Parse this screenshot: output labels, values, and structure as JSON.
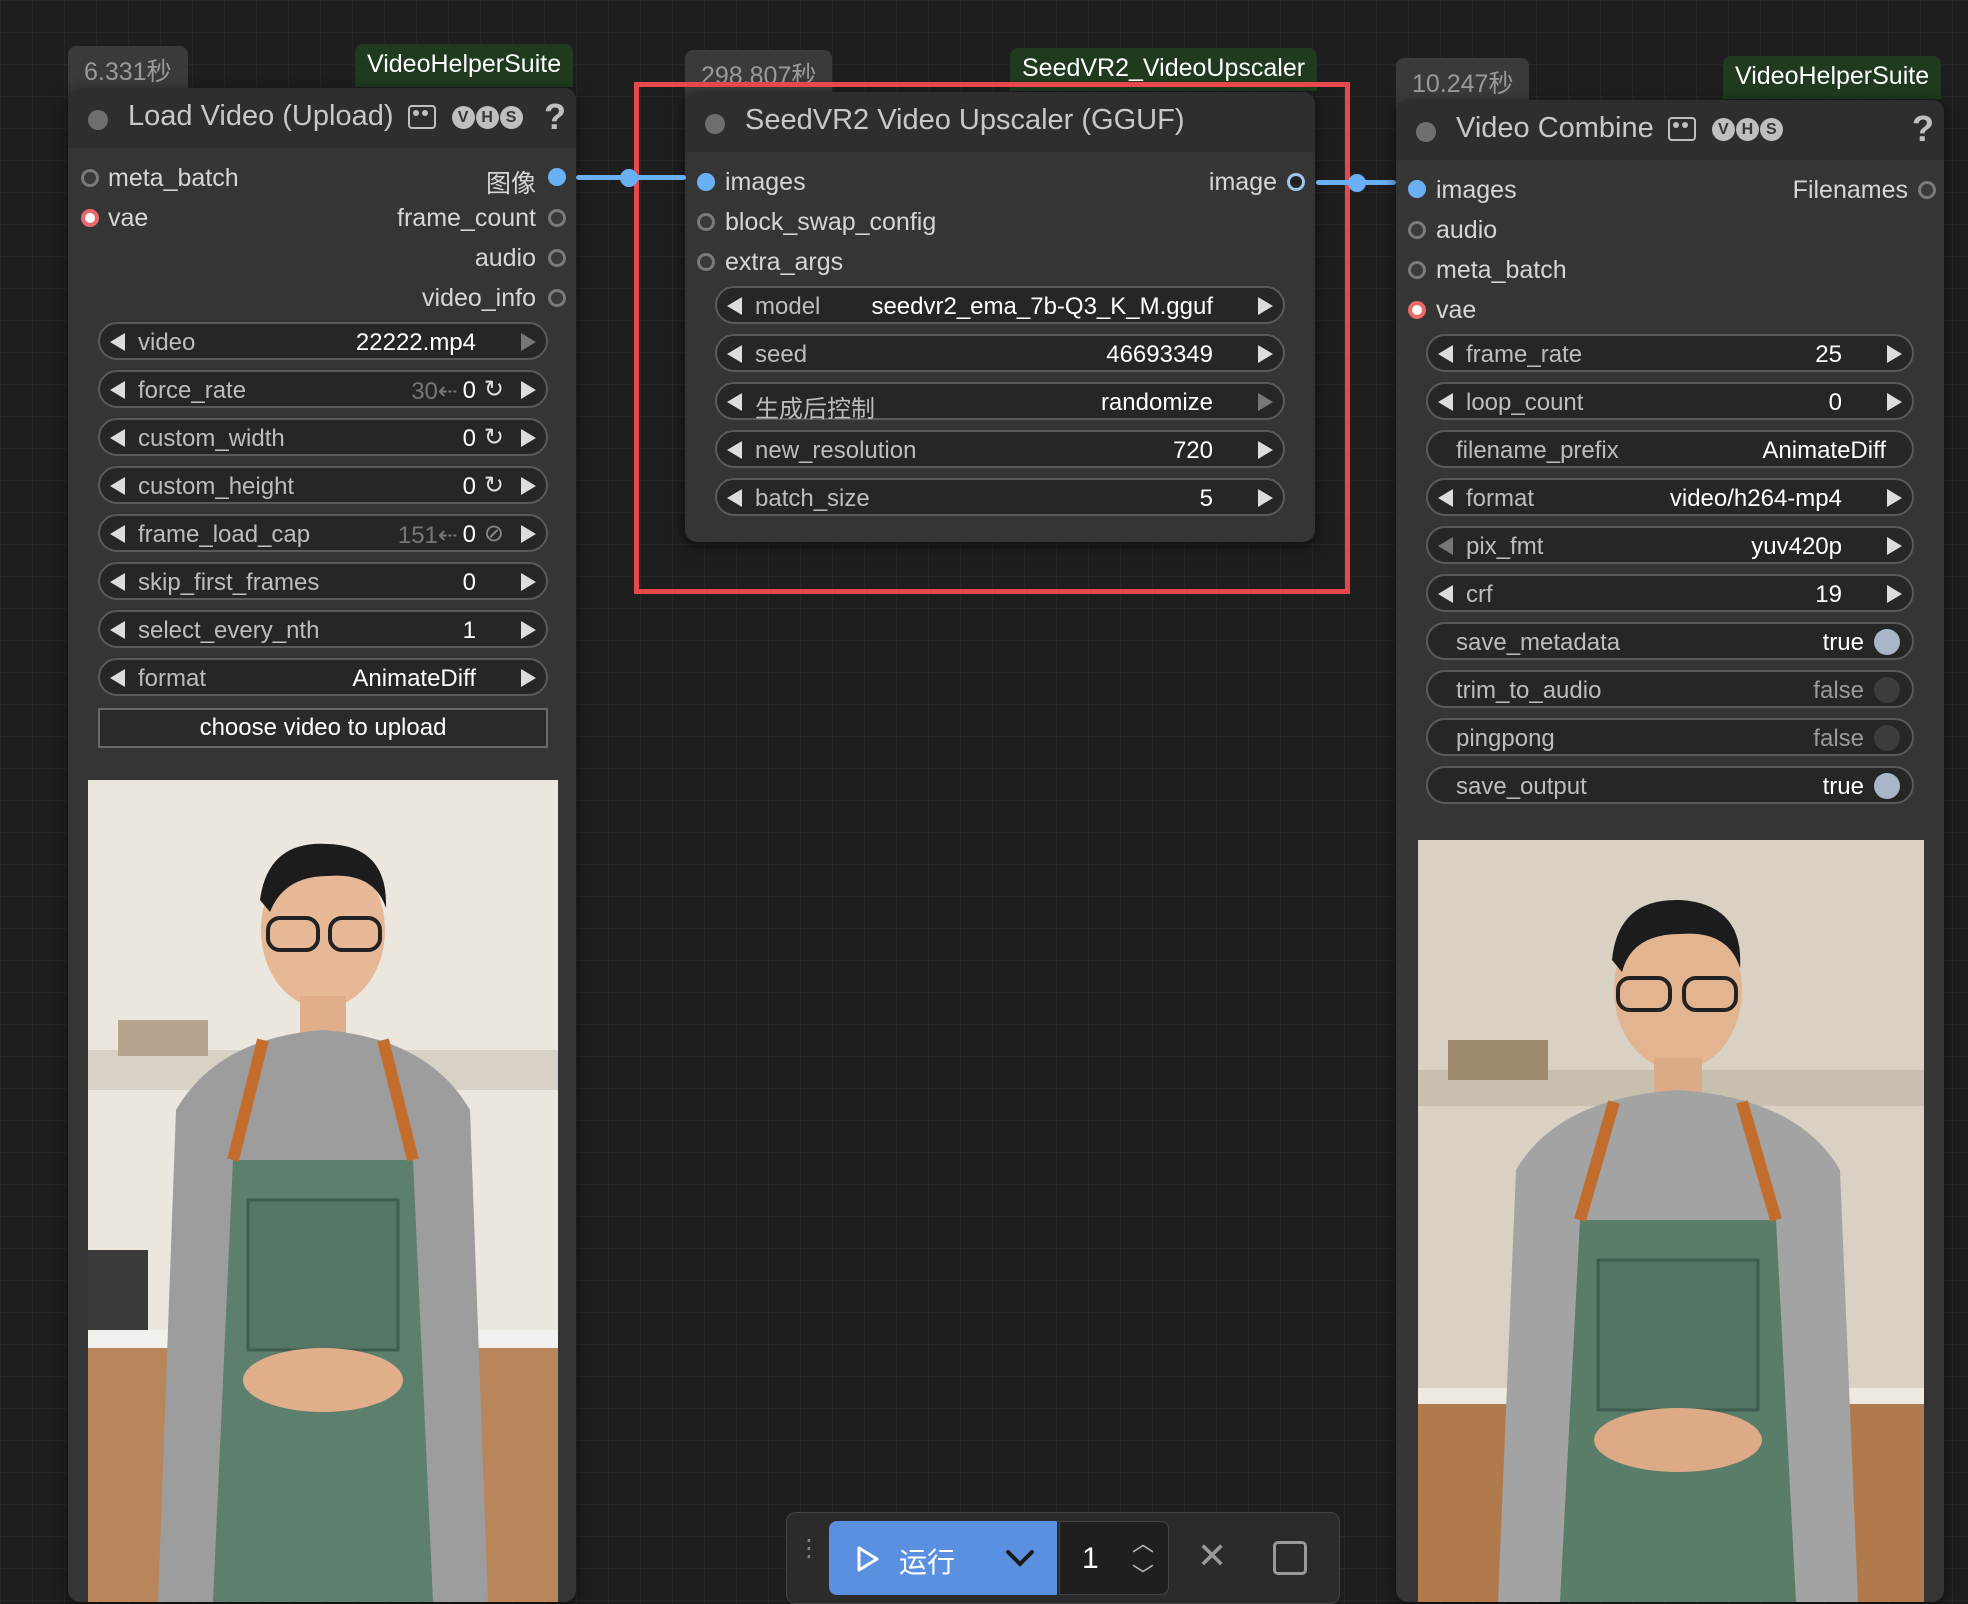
{
  "colors": {
    "accent": "#6ab0f5",
    "highlight": "#e8474b",
    "run_button": "#5b8fe0",
    "badge_bg": "#1f3a1f"
  },
  "nodes": {
    "load_video": {
      "time": "6.331秒",
      "suite": "VideoHelperSuite",
      "title": "Load Video (Upload)",
      "inputs": [
        "meta_batch",
        "vae"
      ],
      "outputs": [
        "图像",
        "frame_count",
        "audio",
        "video_info"
      ],
      "widgets": {
        "video": {
          "label": "video",
          "value": "22222.mp4"
        },
        "force_rate": {
          "label": "force_rate",
          "hint": "30⇠",
          "value": "0"
        },
        "custom_width": {
          "label": "custom_width",
          "value": "0"
        },
        "custom_height": {
          "label": "custom_height",
          "value": "0"
        },
        "frame_load_cap": {
          "label": "frame_load_cap",
          "hint": "151⇠",
          "value": "0"
        },
        "skip_first_frames": {
          "label": "skip_first_frames",
          "value": "0"
        },
        "select_every_nth": {
          "label": "select_every_nth",
          "value": "1"
        },
        "format": {
          "label": "format",
          "value": "AnimateDiff"
        }
      },
      "upload_button": "choose video to upload"
    },
    "upscaler": {
      "time": "298.807秒",
      "suite": "SeedVR2_VideoUpscaler",
      "title": "SeedVR2 Video Upscaler (GGUF)",
      "inputs": [
        "images",
        "block_swap_config",
        "extra_args"
      ],
      "outputs": [
        "image"
      ],
      "widgets": {
        "model": {
          "label": "model",
          "value": "seedvr2_ema_7b-Q3_K_M.gguf"
        },
        "seed": {
          "label": "seed",
          "value": "46693349"
        },
        "control": {
          "label": "生成后控制",
          "value": "randomize"
        },
        "new_resolution": {
          "label": "new_resolution",
          "value": "720"
        },
        "batch_size": {
          "label": "batch_size",
          "value": "5"
        }
      }
    },
    "video_combine": {
      "time": "10.247秒",
      "suite": "VideoHelperSuite",
      "title": "Video Combine",
      "inputs": [
        "images",
        "audio",
        "meta_batch",
        "vae"
      ],
      "outputs": [
        "Filenames"
      ],
      "widgets": {
        "frame_rate": {
          "label": "frame_rate",
          "value": "25"
        },
        "loop_count": {
          "label": "loop_count",
          "value": "0"
        },
        "filename_prefix": {
          "label": "filename_prefix",
          "value": "AnimateDiff"
        },
        "format": {
          "label": "format",
          "value": "video/h264-mp4"
        },
        "pix_fmt": {
          "label": "pix_fmt",
          "value": "yuv420p"
        },
        "crf": {
          "label": "crf",
          "value": "19"
        },
        "save_metadata": {
          "label": "save_metadata",
          "value": "true"
        },
        "trim_to_audio": {
          "label": "trim_to_audio",
          "value": "false"
        },
        "pingpong": {
          "label": "pingpong",
          "value": "false"
        },
        "save_output": {
          "label": "save_output",
          "value": "true"
        }
      }
    }
  },
  "toolbar": {
    "run_label": "运行",
    "batch_count": "1"
  }
}
